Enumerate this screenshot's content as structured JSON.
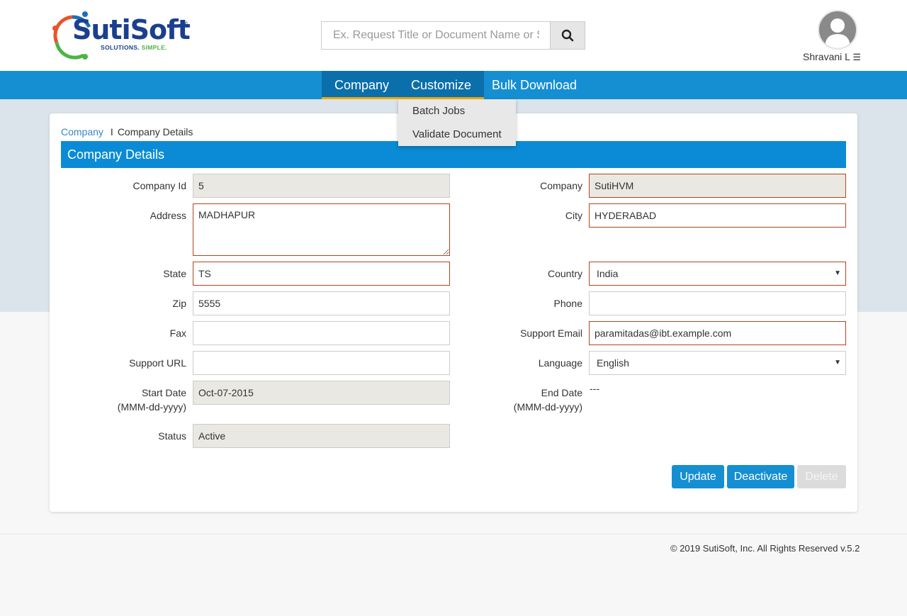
{
  "brand": {
    "name": "SutiSoft",
    "registered": "®",
    "tagline_1": "SOLUTIONS.",
    "tagline_2": "SIMPLE."
  },
  "search": {
    "placeholder": "Ex. Request Title or Document Name or S"
  },
  "user": {
    "name": "Shravani L"
  },
  "nav": {
    "items": [
      {
        "label": "Company"
      },
      {
        "label": "Customize"
      },
      {
        "label": "Bulk Download"
      }
    ]
  },
  "dropdown": {
    "items": [
      {
        "label": "Batch Jobs"
      },
      {
        "label": "Validate Document"
      }
    ]
  },
  "breadcrumb": {
    "link": "Company",
    "separator": "I",
    "current": "Company Details"
  },
  "section": {
    "title": "Company Details"
  },
  "form": {
    "company_id": {
      "label": "Company Id",
      "value": "5"
    },
    "company": {
      "label": "Company",
      "value": "SutiHVM"
    },
    "address": {
      "label": "Address",
      "value": "MADHAPUR"
    },
    "city": {
      "label": "City",
      "value": "HYDERABAD"
    },
    "state": {
      "label": "State",
      "value": "TS"
    },
    "country": {
      "label": "Country",
      "value": "India"
    },
    "zip": {
      "label": "Zip",
      "value": "5555"
    },
    "phone": {
      "label": "Phone",
      "value": ""
    },
    "fax": {
      "label": "Fax",
      "value": ""
    },
    "support_email": {
      "label": "Support Email",
      "value": "paramitadas@ibt.example.com"
    },
    "support_url": {
      "label": "Support URL",
      "value": ""
    },
    "language": {
      "label": "Language",
      "value": "English"
    },
    "start_date": {
      "label": "Start Date",
      "format": "(MMM-dd-yyyy)",
      "value": "Oct-07-2015"
    },
    "end_date": {
      "label": "End Date",
      "format": "(MMM-dd-yyyy)",
      "value": "---"
    },
    "status": {
      "label": "Status",
      "value": "Active"
    }
  },
  "buttons": {
    "update": "Update",
    "deactivate": "Deactivate",
    "delete": "Delete"
  },
  "footer": {
    "text": "© 2019 SutiSoft, Inc. All Rights Reserved v.5.2"
  },
  "colors": {
    "nav": "#158fd2",
    "nav_active": "#0b6fab",
    "active_underline": "#f2a900",
    "section_bar": "#0b8bd5",
    "required_border": "#b5441b",
    "readonly_bg": "#e9e8e3"
  }
}
